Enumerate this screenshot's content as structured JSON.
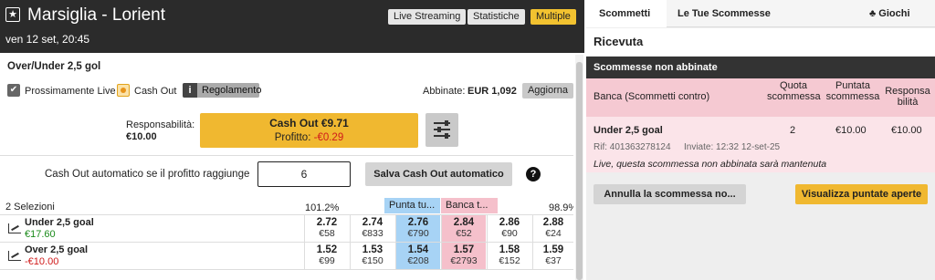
{
  "header": {
    "title": "Marsiglia - Lorient",
    "date": "ven 12 set, 20:45",
    "buttons": [
      "Live Streaming",
      "Statistiche",
      "Multiple"
    ]
  },
  "market": {
    "title": "Over/Under 2,5 gol",
    "prossimamente_live": "Prossimamente Live",
    "cash_out_label": "Cash Out",
    "info_icon": "i",
    "regolamento": "Regolamento",
    "abbinate_label": "Abbinate:",
    "abbinate_value": "EUR 1,092",
    "aggiorna": "Aggiorna"
  },
  "cashout": {
    "responsabilita_label": "Responsabilità:",
    "responsabilita_value": "€10.00",
    "button_main": "Cash Out €9.71",
    "profitto_label": "Profitto:",
    "profitto_value": "-€0.29"
  },
  "auto_cashout": {
    "label": "Cash Out automatico se il profitto raggiunge",
    "value": "6",
    "save_button": "Salva Cash Out automatico",
    "help_icon": "?"
  },
  "selections": {
    "count_label": "2 Selezioni",
    "back_pct": "101.2%",
    "lay_pct": "98.9%",
    "back_header": "Punta tu...",
    "lay_header": "Banca t...",
    "rows": [
      {
        "name": "Under 2,5 goal",
        "pl": "€17.60",
        "pl_color": "#1a8a1a",
        "cells": [
          {
            "odds": "2.72",
            "stake": "€58"
          },
          {
            "odds": "2.74",
            "stake": "€833"
          },
          {
            "odds": "2.76",
            "stake": "€790"
          },
          {
            "odds": "2.84",
            "stake": "€52"
          },
          {
            "odds": "2.86",
            "stake": "€90"
          },
          {
            "odds": "2.88",
            "stake": "€24"
          }
        ]
      },
      {
        "name": "Over 2,5 goal",
        "pl": "-€10.00",
        "pl_color": "#d01a1a",
        "cells": [
          {
            "odds": "1.52",
            "stake": "€99"
          },
          {
            "odds": "1.53",
            "stake": "€150"
          },
          {
            "odds": "1.54",
            "stake": "€208"
          },
          {
            "odds": "1.57",
            "stake": "€2793"
          },
          {
            "odds": "1.58",
            "stake": "€152"
          },
          {
            "odds": "1.59",
            "stake": "€37"
          }
        ]
      }
    ]
  },
  "betslip": {
    "tabs": [
      "Scommetti",
      "Le Tue Scommesse",
      "Giochi"
    ],
    "received": "Ricevuta",
    "section_title": "Scommesse non abbinate",
    "columns": [
      "Banca (Scommetti contro)",
      "Quota scommessa",
      "Puntata scommessa",
      "Responsabilità"
    ],
    "bet": {
      "name": "Under 2,5 goal",
      "quota": "2",
      "puntata": "€10.00",
      "responsabilita": "€10.00",
      "rif": "Rif: 401363278124",
      "inviate": "Inviate: 12:32 12-set-25",
      "note": "Live, questa scommessa non abbinata sarà mantenuta"
    },
    "cancel_button": "Annulla la scommessa no...",
    "view_button": "Visualizza puntate aperte"
  },
  "colors": {
    "header_bg": "#2b2b2b",
    "accent_yellow": "#f0b830",
    "back_blue": "#a7d3f5",
    "lay_pink": "#f5c0cb",
    "profit_red": "#d01a1a",
    "profit_green": "#1a8a1a"
  }
}
